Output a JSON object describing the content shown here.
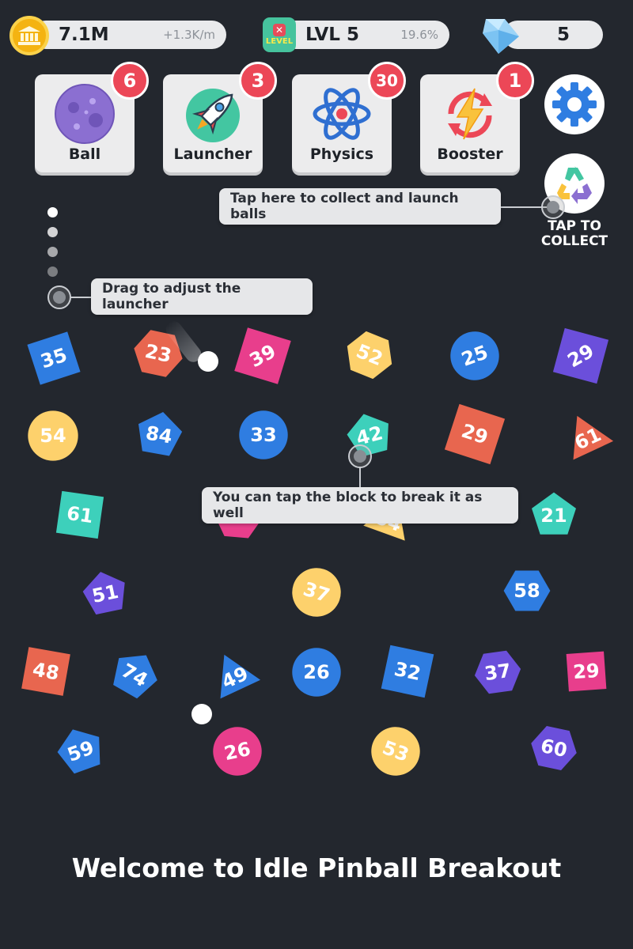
{
  "hud": {
    "coins": "7.1M",
    "coin_rate": "+1.3K/m",
    "level": "LVL 5",
    "level_progress": "19.6%",
    "level_progress_fraction": 0.196,
    "level_badge_text": "LEVEL",
    "gems": "5"
  },
  "upgrades": [
    {
      "label": "Ball",
      "badge": "6",
      "icon": "planet-ball-icon"
    },
    {
      "label": "Launcher",
      "badge": "3",
      "icon": "rocket-icon"
    },
    {
      "label": "Physics",
      "badge": "30",
      "icon": "atom-icon"
    },
    {
      "label": "Booster",
      "badge": "1",
      "icon": "lightning-booster-icon"
    }
  ],
  "collect": {
    "label_line1": "TAP TO",
    "label_line2": "COLLECT"
  },
  "tips": {
    "collect": "Tap here to collect and launch balls",
    "launcher": "Drag to adjust the launcher",
    "tap_block": "You can tap the block to break it as well"
  },
  "colors": {
    "blue": "#2f7de1",
    "orange": "#e8664f",
    "pink": "#e83e8c",
    "yellow": "#fdd16c",
    "purple": "#6b4fdb",
    "teal": "#3dd0bb",
    "background": "#23272e"
  },
  "blocks": [
    {
      "value": "35",
      "shape": "square",
      "color": "blue"
    },
    {
      "value": "23",
      "shape": "hexagon",
      "color": "orange"
    },
    {
      "value": "39",
      "shape": "diamond",
      "color": "pink"
    },
    {
      "value": "52",
      "shape": "hexagon",
      "color": "yellow"
    },
    {
      "value": "25",
      "shape": "circle",
      "color": "blue"
    },
    {
      "value": "29",
      "shape": "diamond",
      "color": "purple"
    },
    {
      "value": "54",
      "shape": "circle",
      "color": "yellow"
    },
    {
      "value": "84",
      "shape": "pentagon",
      "color": "blue"
    },
    {
      "value": "33",
      "shape": "circle",
      "color": "blue"
    },
    {
      "value": "42",
      "shape": "pentagon",
      "color": "teal"
    },
    {
      "value": "29",
      "shape": "square",
      "color": "orange"
    },
    {
      "value": "61",
      "shape": "triangle",
      "color": "orange"
    },
    {
      "value": "61",
      "shape": "square",
      "color": "teal"
    },
    {
      "value": "",
      "shape": "hexagon",
      "color": "pink"
    },
    {
      "value": "54",
      "shape": "triangle",
      "color": "yellow"
    },
    {
      "value": "21",
      "shape": "pentagon",
      "color": "teal"
    },
    {
      "value": "51",
      "shape": "pentagon",
      "color": "purple"
    },
    {
      "value": "37",
      "shape": "circle",
      "color": "yellow"
    },
    {
      "value": "58",
      "shape": "hexagon",
      "color": "blue"
    },
    {
      "value": "48",
      "shape": "square",
      "color": "orange"
    },
    {
      "value": "74",
      "shape": "pentagon",
      "color": "blue"
    },
    {
      "value": "49",
      "shape": "triangle",
      "color": "blue"
    },
    {
      "value": "26",
      "shape": "circle",
      "color": "blue"
    },
    {
      "value": "32",
      "shape": "square",
      "color": "blue"
    },
    {
      "value": "37",
      "shape": "hexagon",
      "color": "purple"
    },
    {
      "value": "29",
      "shape": "square",
      "color": "pink"
    },
    {
      "value": "59",
      "shape": "pentagon",
      "color": "blue"
    },
    {
      "value": "26",
      "shape": "circle",
      "color": "pink"
    },
    {
      "value": "53",
      "shape": "circle",
      "color": "yellow"
    },
    {
      "value": "60",
      "shape": "hexagon",
      "color": "purple"
    }
  ],
  "welcome": "Welcome to Idle Pinball Breakout"
}
